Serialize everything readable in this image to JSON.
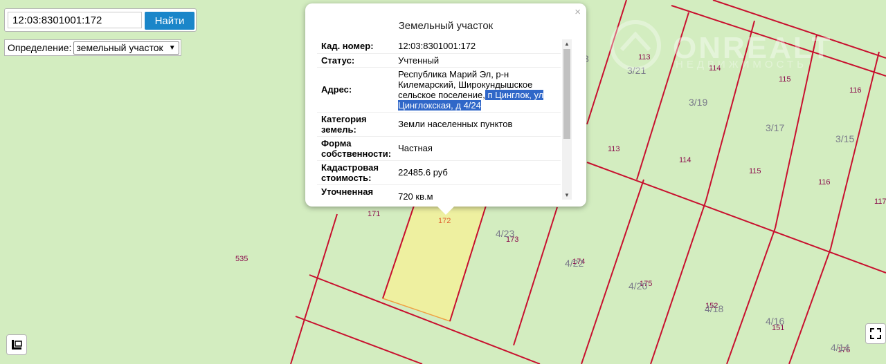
{
  "search": {
    "value": "12:03:8301001:172",
    "button_label": "Найти"
  },
  "definition": {
    "label": "Определение:",
    "selected": "земельный участок"
  },
  "popup": {
    "title": "Земельный участок",
    "close_glyph": "×",
    "rows": [
      {
        "key": "Кад. номер",
        "value": "12:03:8301001:172"
      },
      {
        "key": "Статус",
        "value": "Учтенный"
      },
      {
        "key": "Адрес",
        "value_plain": "Республика Марий Эл, р-н Килемарский, Широкундышское сельское поселение,",
        "value_highlight": " п Цинглок, ул Цинглокская, д 4/24"
      },
      {
        "key": "Категория земель",
        "value": "Земли населенных пунктов"
      },
      {
        "key": "Форма собственности",
        "value": "Частная"
      },
      {
        "key": "Кадастровая стоимость",
        "value": "22485.6 руб"
      },
      {
        "key": "Уточненная площадь",
        "value": "720 кв.м"
      }
    ]
  },
  "watermark": {
    "brand": "ONREALT",
    "tagline": "НЕДВИЖИМОСТЬ"
  },
  "map_labels": {
    "selected_parcel": "172",
    "parcels": [
      "113",
      "114",
      "115",
      "116",
      "113",
      "114",
      "115",
      "116",
      "117",
      "171",
      "173",
      "174",
      "175",
      "152",
      "151",
      "176",
      "535"
    ],
    "blocks": [
      "3/21",
      "3/19",
      "3/17",
      "3/15",
      "4/23",
      "4/22",
      "4/20",
      "4/18",
      "4/16",
      "4/14",
      "3"
    ]
  },
  "colors": {
    "map_bg": "#d3edc0",
    "parcel_line": "#c8102e",
    "selected_fill": "#eef0a0",
    "label_color": "#8b0b4b",
    "button_blue": "#1a86c9",
    "highlight": "#3067c8"
  },
  "icons": [
    "layers-icon",
    "fullscreen-icon",
    "close-icon",
    "chevron-down-icon",
    "scroll-up-icon",
    "scroll-down-icon",
    "house-logo-icon"
  ]
}
